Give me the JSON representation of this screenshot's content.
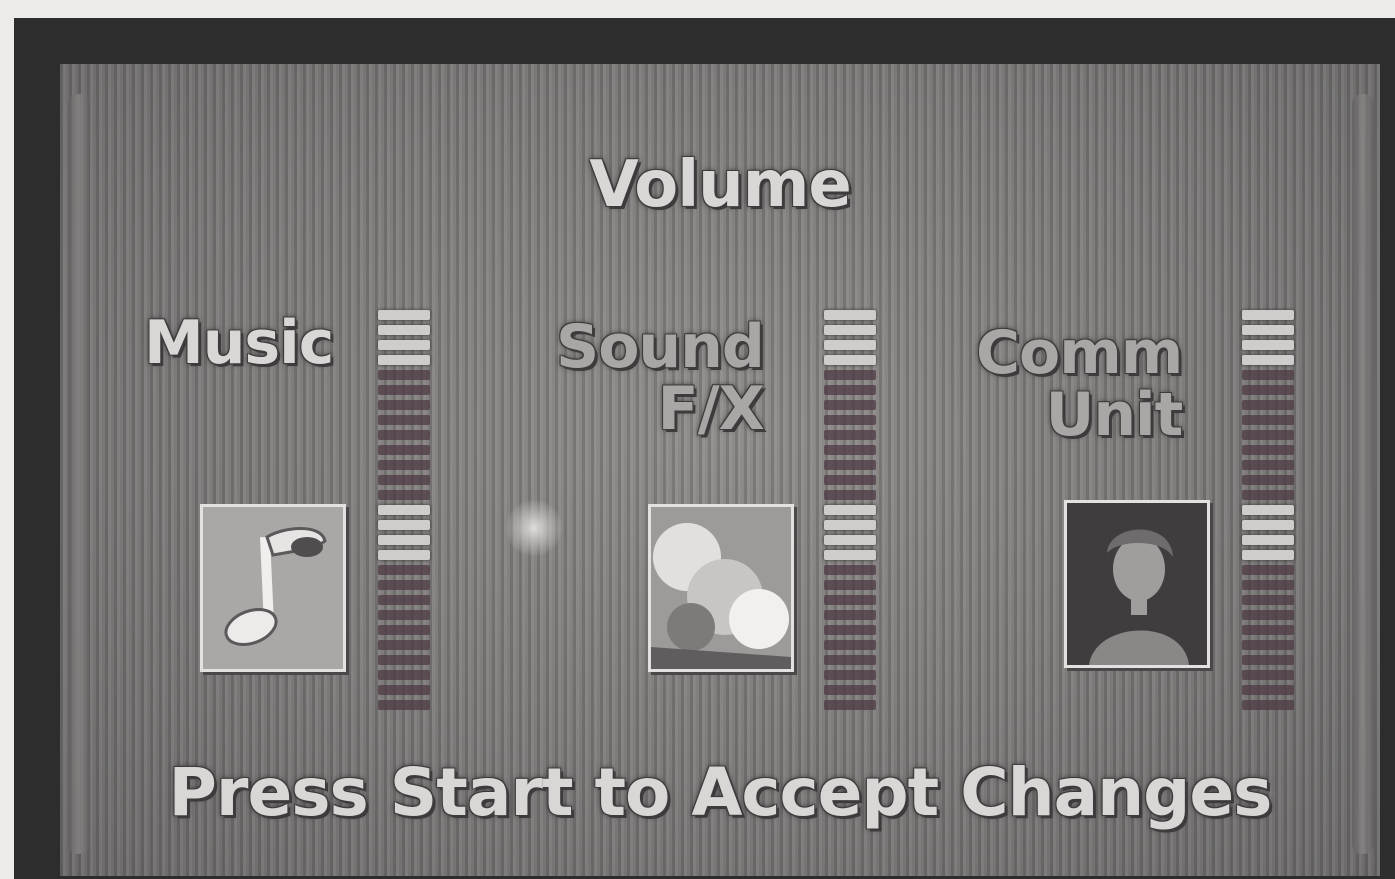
{
  "screen": {
    "title": "Volume",
    "footer": "Press Start to Accept Changes"
  },
  "channels": [
    {
      "label_line1": "Music",
      "label_line2": "",
      "icon": "music-note-icon",
      "level_fraction": 0.3,
      "selected": true
    },
    {
      "label_line1": "Sound",
      "label_line2": "F/X",
      "icon": "explosion-icon",
      "level_fraction": 0.3,
      "selected": false
    },
    {
      "label_line1": "Comm",
      "label_line2": "Unit",
      "icon": "comm-officer-portrait-icon",
      "level_fraction": 0.3,
      "selected": false
    }
  ],
  "colors": {
    "bezel": "#2e2d2e",
    "screen": "#8a8887",
    "text": "#d9d7d6",
    "meter_on": "#cfcdcc",
    "meter_off": "#4e3a44"
  }
}
